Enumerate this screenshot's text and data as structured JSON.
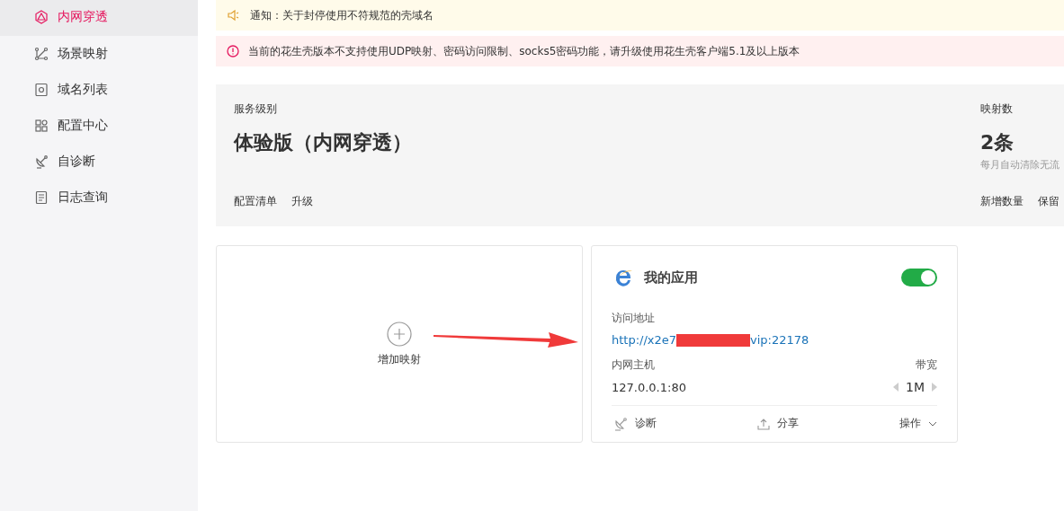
{
  "sidebar": {
    "items": [
      {
        "label": "内网穿透",
        "selected": true
      },
      {
        "label": "场景映射",
        "selected": false
      },
      {
        "label": "域名列表",
        "selected": false
      },
      {
        "label": "配置中心",
        "selected": false
      },
      {
        "label": "自诊断",
        "selected": false
      },
      {
        "label": "日志查询",
        "selected": false
      }
    ]
  },
  "notices": [
    {
      "kind": "info",
      "text": "通知：关于封停使用不符规范的壳域名"
    },
    {
      "kind": "warning",
      "text": "当前的花生壳版本不支持使用UDP映射、密码访问限制、socks5密码功能，请升级使用花生壳客户端5.1及以上版本"
    }
  ],
  "service_panel": {
    "level_label": "服务级别",
    "level_value": "体验版（内网穿透）",
    "links": [
      "配置清单",
      "升级"
    ],
    "mapping_label": "映射数",
    "mapping_value": "2条",
    "mapping_note": "每月自动清除无流",
    "mapping_links": [
      "新增数量",
      "保留"
    ]
  },
  "add_card": {
    "label": "增加映射"
  },
  "app_card": {
    "title": "我的应用",
    "on": true,
    "address_label": "访问地址",
    "address_start": "http://x2e7",
    "address_end": "vip:22178",
    "address_redacted": true,
    "host_label": "内网主机",
    "host_value": "127.0.0.1:80",
    "bandwidth_label": "带宽",
    "bandwidth_value": "1M",
    "actions": [
      {
        "kind": "diagnose",
        "label": "诊断"
      },
      {
        "kind": "share",
        "label": "分享"
      },
      {
        "kind": "menu",
        "label": "操作"
      }
    ]
  },
  "annotation_arrow": true
}
